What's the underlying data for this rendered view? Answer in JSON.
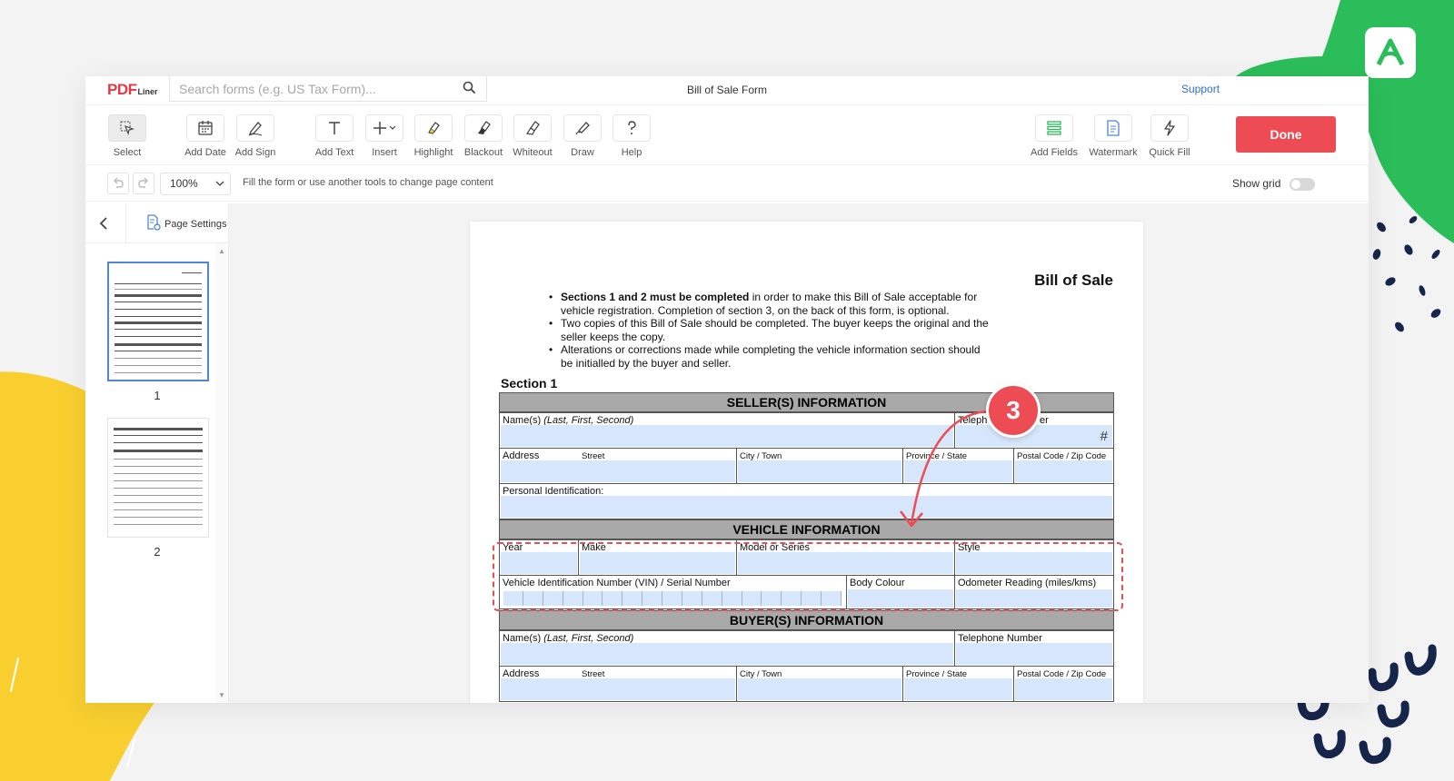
{
  "app": {
    "logo_main": "PDF",
    "logo_sub": "Liner",
    "search_placeholder": "Search forms (e.g. US Tax Form)...",
    "doc_title": "Bill of Sale Form",
    "support_label": "Support"
  },
  "toolbar": {
    "tools": [
      {
        "label": "Select",
        "icon": "select-cursor-icon"
      },
      {
        "label": "Add Date",
        "icon": "calendar-icon"
      },
      {
        "label": "Add Sign",
        "icon": "signature-pen-icon"
      },
      {
        "label": "Add Text",
        "icon": "text-t-icon"
      },
      {
        "label": "Insert",
        "icon": "plus-icon"
      },
      {
        "label": "Highlight",
        "icon": "highlighter-icon"
      },
      {
        "label": "Blackout",
        "icon": "blackout-brush-icon"
      },
      {
        "label": "Whiteout",
        "icon": "whiteout-brush-icon"
      },
      {
        "label": "Draw",
        "icon": "draw-pencil-icon"
      },
      {
        "label": "Help",
        "icon": "question-icon"
      },
      {
        "label": "Add Fields",
        "icon": "fields-icon"
      },
      {
        "label": "Watermark",
        "icon": "watermark-icon"
      },
      {
        "label": "Quick Fill",
        "icon": "lightning-icon"
      }
    ],
    "done_label": "Done"
  },
  "subbar": {
    "zoom": "100%",
    "hint": "Fill the form or use another tools to change page content",
    "show_grid_label": "Show grid"
  },
  "sidebar": {
    "page_settings_label": "Page Settings",
    "pages": [
      "1",
      "2"
    ]
  },
  "document": {
    "title": "Bill of Sale",
    "bullet1_bold": "Sections 1 and 2 must be completed",
    "bullet1_rest_a": " in order to make this Bill of Sale acceptable for",
    "bullet1_rest_b": "vehicle registration. Completion of section 3, on the back of this form, is optional.",
    "bullet2_a": "Two copies of this Bill of Sale should be completed. The buyer keeps the original and the",
    "bullet2_b": "seller keeps the copy.",
    "bullet3_a": "Alterations or corrections made while completing the vehicle information section should",
    "bullet3_b": "be initialled by the buyer and seller.",
    "section1": "Section 1",
    "seller_header": "SELLER(S) INFORMATION",
    "vehicle_header": "VEHICLE INFORMATION",
    "buyer_header": "BUYER(S) INFORMATION",
    "names_label": "Name(s) ",
    "names_italic": "(Last, First, Second)",
    "telephone_label": "Telephone Number",
    "telephone_visible_a": "Teleph",
    "telephone_visible_b": "er",
    "hash": "#",
    "address_label": "Address",
    "street_label": "Street",
    "city_label": "City / Town",
    "province_label": "Province / State",
    "postal_label": "Postal Code / Zip Code",
    "personal_id_label": "Personal Identification:",
    "year_label": "Year",
    "make_label": "Make",
    "model_label": "Model or Series",
    "style_label": "Style",
    "vin_label": "Vehicle Identification Number (VIN) / Serial Number",
    "body_colour_label": "Body Colour",
    "odometer_label": "Odometer Reading (miles/kms)"
  },
  "annotation": {
    "step_number": "3",
    "accent_color": "#ee4c55"
  },
  "colors": {
    "brand_red": "#ee4c55",
    "field_blue": "#d6e6fb",
    "link_blue": "#2f6fd6",
    "deco_green": "#2bbd5a",
    "deco_yellow": "#f8cf2f",
    "deco_navy": "#16254a"
  }
}
